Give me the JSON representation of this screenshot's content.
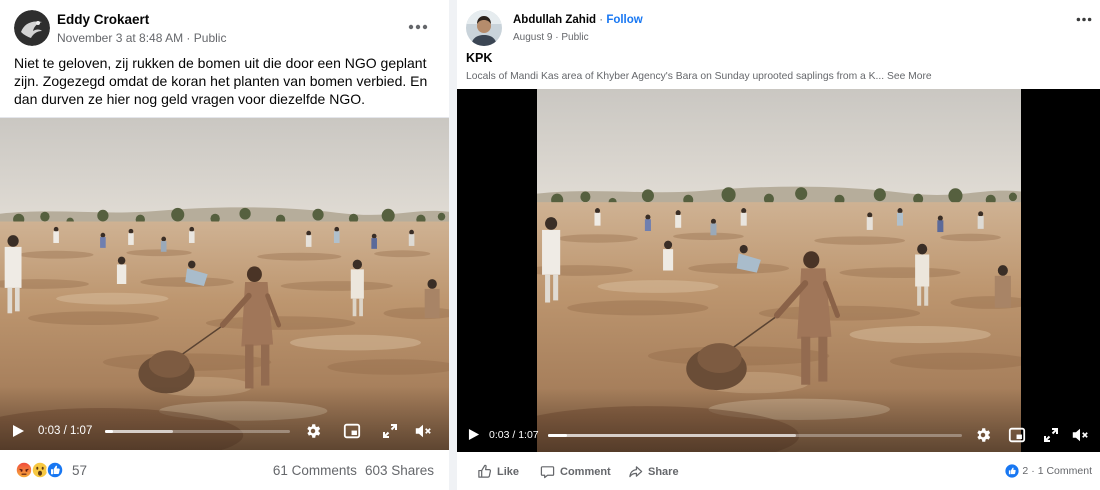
{
  "posts": [
    {
      "author": "Eddy Crokaert",
      "timestamp": "November 3 at 8:48 AM",
      "separator": "·",
      "audience": "Public",
      "text": "Niet te geloven, zij rukken de bomen uit die door een NGO geplant zijn. Zogezegd omdat de koran het planten van bomen verbied. En dan durven ze hier nog geld vragen voor diezelfde NGO.",
      "video": {
        "time": "0:03 / 1:07",
        "played": 0.045,
        "buffered": 0.37,
        "volume_icon": "volume-muted-icon"
      },
      "reactions": {
        "icons": [
          "angry-reaction-icon",
          "wow-reaction-icon",
          "like-reaction-icon"
        ],
        "count": "57"
      },
      "comments": "61 Comments",
      "shares": "603 Shares"
    },
    {
      "author": "Abdullah Zahid",
      "separator": "·",
      "follow": "Follow",
      "timestamp": "August 9",
      "audience": "Public",
      "title": "KPK",
      "caption": "Locals of Mandi Kas area of Khyber Agency's Bara on Sunday uprooted saplings from a K...",
      "see_more": "See More",
      "video": {
        "time": "0:03 / 1:07",
        "played": 0.045,
        "buffered": 0.6,
        "volume_icon": "volume-muted-icon"
      },
      "actions": {
        "like": "Like",
        "comment": "Comment",
        "share": "Share"
      },
      "reactions": {
        "icons": [
          "like-reaction-icon"
        ],
        "count": "2"
      },
      "comments": "1 Comment"
    }
  ],
  "colors": {
    "link": "#1877f2",
    "text": "#050505",
    "muted": "#65676b",
    "page_bg": "#f0f2f5"
  }
}
